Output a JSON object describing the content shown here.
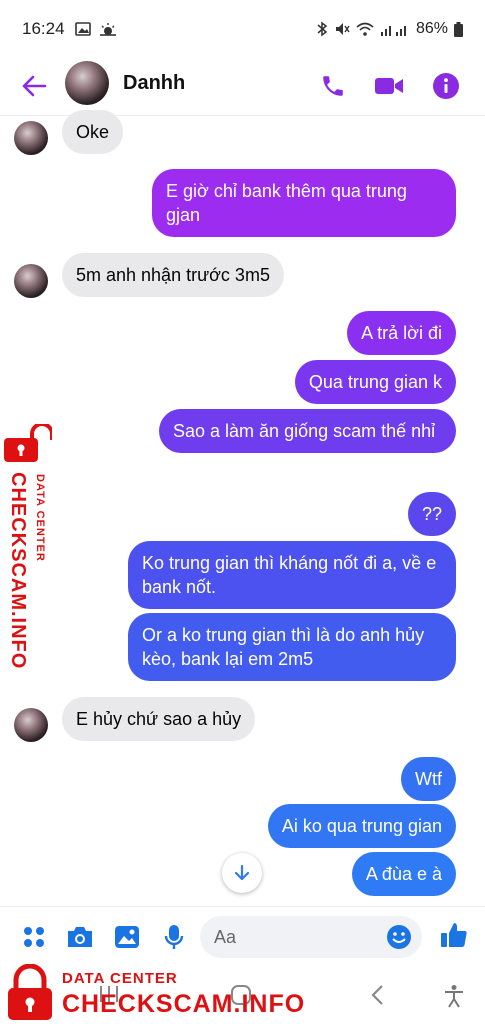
{
  "status_bar": {
    "time": "16:24",
    "battery": "86%"
  },
  "header": {
    "contact_name": "Danhh"
  },
  "messages": [
    {
      "dir": "in",
      "text": "Oke"
    },
    {
      "dir": "out",
      "text": "E giờ chỉ bank thêm qua trung gjan"
    },
    {
      "dir": "in",
      "text": "5m anh nhận trước 3m5"
    },
    {
      "dir": "out",
      "text": "A trả lời đi"
    },
    {
      "dir": "out",
      "text": "Qua trung gian k"
    },
    {
      "dir": "out",
      "text": "Sao a làm ăn giống scam thế nhỉ"
    },
    {
      "dir": "out",
      "text": "??"
    },
    {
      "dir": "out",
      "text": "Ko trung gian thì kháng nốt đi a, về e bank nốt."
    },
    {
      "dir": "out",
      "text": "Or a ko trung gian thì là do anh hủy kèo, bank lại em 2m5"
    },
    {
      "dir": "in",
      "text": "E hủy chứ sao a hủy"
    },
    {
      "dir": "out",
      "text": "Wtf"
    },
    {
      "dir": "out",
      "text": "Ai ko qua trung gian"
    },
    {
      "dir": "out",
      "text": "A đùa e à"
    }
  ],
  "composer": {
    "placeholder": "Aa"
  },
  "watermark": {
    "line1": "DATA CENTER",
    "line2": "CHECKSCAM.INFO"
  },
  "colors": {
    "accent": "#8a2be2",
    "incoming_bubble": "#e9e9eb",
    "watermark_red": "#dd1111",
    "gradient_top": "#9b2cf0",
    "gradient_bottom": "#2f7bf5"
  },
  "icons": {
    "status": [
      "image-icon",
      "weather-icon",
      "bluetooth-icon",
      "mute-icon",
      "wifi-icon",
      "signal-icon",
      "battery-icon"
    ],
    "header": [
      "back-arrow-icon",
      "phone-icon",
      "video-camera-icon",
      "info-icon"
    ],
    "composer": [
      "apps-grid-icon",
      "camera-icon",
      "gallery-icon",
      "microphone-icon",
      "emoji-icon",
      "like-icon"
    ],
    "nav": [
      "recents-icon",
      "home-icon",
      "back-icon",
      "accessibility-icon"
    ]
  }
}
